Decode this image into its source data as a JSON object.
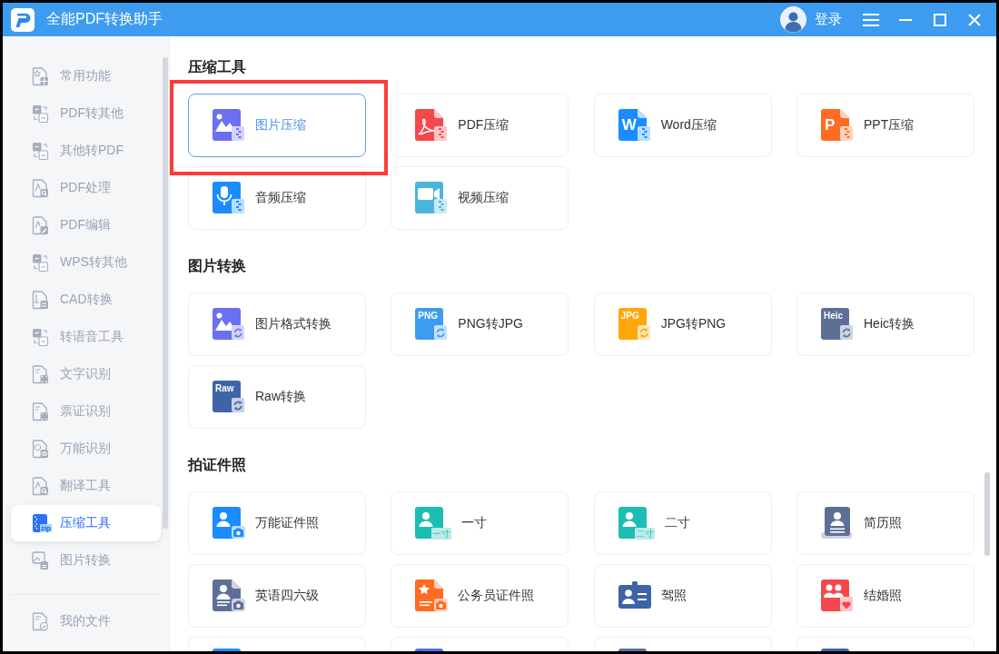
{
  "window": {
    "title": "全能PDF转换助手",
    "login": "登录"
  },
  "sidebar": {
    "items": [
      {
        "label": "常用功能",
        "kind": "favorites",
        "selected": false
      },
      {
        "label": "PDF转其他",
        "kind": "swap",
        "selected": false
      },
      {
        "label": "其他转PDF",
        "kind": "swap",
        "selected": false
      },
      {
        "label": "PDF处理",
        "kind": "search",
        "selected": false
      },
      {
        "label": "PDF编辑",
        "kind": "pen",
        "selected": false
      },
      {
        "label": "WPS转其他",
        "kind": "swap",
        "selected": false
      },
      {
        "label": "CAD转换",
        "kind": "cad",
        "selected": false
      },
      {
        "label": "转语音工具",
        "kind": "swap",
        "selected": false
      },
      {
        "label": "文字识别",
        "kind": "scan",
        "selected": false
      },
      {
        "label": "票证识别",
        "kind": "scan",
        "selected": false
      },
      {
        "label": "万能识别",
        "kind": "eye",
        "selected": false
      },
      {
        "label": "翻译工具",
        "kind": "search",
        "selected": false
      },
      {
        "label": "压缩工具",
        "kind": "zip",
        "icon_text": "zip",
        "selected": true
      },
      {
        "label": "图片转换",
        "kind": "image",
        "selected": false
      }
    ],
    "footer_item": {
      "label": "我的文件",
      "kind": "check"
    }
  },
  "sections": [
    {
      "title": "压缩工具",
      "cards": [
        {
          "kind": "picture",
          "label": "图片压缩",
          "color": "#6b70f0",
          "selected": true,
          "annotated": true
        },
        {
          "kind": "pdf",
          "label": "PDF压缩",
          "color": "#f5484d",
          "selected": false
        },
        {
          "kind": "letter",
          "label": "Word压缩",
          "icon_text": "W",
          "color": "#1a8cff",
          "selected": false
        },
        {
          "kind": "letter",
          "label": "PPT压缩",
          "icon_text": "P",
          "color": "#ff6b22",
          "selected": false
        },
        {
          "kind": "mic",
          "label": "音频压缩",
          "color": "#1a8cff",
          "selected": false
        },
        {
          "kind": "video",
          "label": "视频压缩",
          "color": "#4cb5dc",
          "selected": false
        }
      ]
    },
    {
      "title": "图片转换",
      "cards": [
        {
          "kind": "convert",
          "label": "图片格式转换",
          "color": "#6b70f0",
          "selected": false
        },
        {
          "kind": "tag",
          "label": "PNG转JPG",
          "icon_text": "PNG",
          "color": "#3d9cf0",
          "selected": false
        },
        {
          "kind": "tag",
          "label": "JPG转PNG",
          "icon_text": "JPG",
          "color": "#ffa60a",
          "selected": false
        },
        {
          "kind": "tag",
          "label": "Heic转换",
          "icon_text": "Heic",
          "color": "#5e6f97",
          "selected": false
        },
        {
          "kind": "tag",
          "label": "Raw转换",
          "icon_text": "Raw",
          "color": "#3f64a6",
          "selected": false
        }
      ]
    },
    {
      "title": "拍证件照",
      "cards": [
        {
          "kind": "portrait",
          "label": "万能证件照",
          "color": "#1a8cff",
          "selected": false
        },
        {
          "kind": "size",
          "label": "一寸",
          "icon_text": "一寸",
          "color": "#1cbdb4",
          "selected": false
        },
        {
          "kind": "size",
          "label": "二寸",
          "icon_text": "二寸",
          "color": "#1cbdb4",
          "selected": false
        },
        {
          "kind": "resume",
          "label": "简历照",
          "color": "#5e6f97",
          "selected": false
        },
        {
          "kind": "exam",
          "label": "英语四六级",
          "color": "#5e6f97",
          "selected": false
        },
        {
          "kind": "official",
          "label": "公务员证件照",
          "color": "#ff6b22",
          "selected": false
        },
        {
          "kind": "license",
          "label": "驾照",
          "color": "#3f64a6",
          "selected": false
        },
        {
          "kind": "couple",
          "label": "结婚照",
          "color": "#f5484d",
          "selected": false
        },
        {
          "kind": "cutoff",
          "color": "#1a8cff"
        },
        {
          "kind": "cutoff",
          "color": "#4e6ef2"
        },
        {
          "kind": "cutoff",
          "color": "#5e6f97"
        },
        {
          "kind": "cutoff",
          "color": "#3f64a6"
        }
      ]
    }
  ]
}
